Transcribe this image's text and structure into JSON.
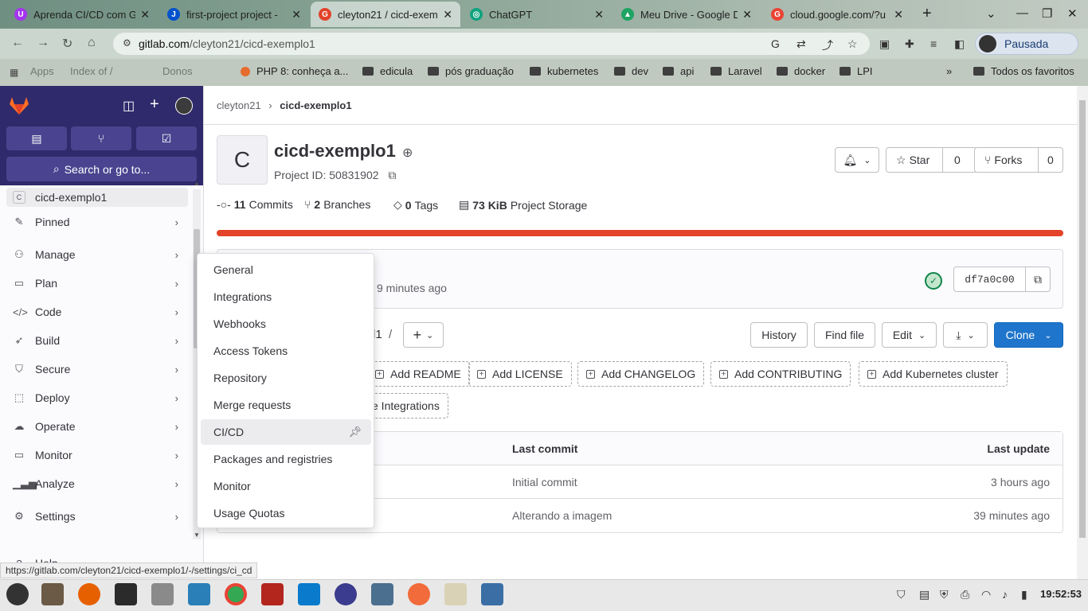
{
  "browser": {
    "tabs": [
      {
        "label": "Aprenda CI/CD com G",
        "icon": "udemy-icon",
        "color": "#a435f0"
      },
      {
        "label": "first-project project -",
        "icon": "jira-icon",
        "color": "#0052cc"
      },
      {
        "label": "cleyton21 / cicd-exem",
        "icon": "gitlab-icon",
        "color": "#e24329"
      },
      {
        "label": "ChatGPT",
        "icon": "chatgpt-icon",
        "color": "#10a37f"
      },
      {
        "label": "Meu Drive - Google D",
        "icon": "google-drive-icon",
        "color": "#1fa463"
      },
      {
        "label": "cloud.google.com/?u",
        "icon": "google-icon",
        "color": "#ea4335"
      }
    ],
    "new_tab": "+",
    "url_domain": "gitlab.com",
    "url_path": "/cleyton21/cicd-exemplo1",
    "profile_label": "Pausada",
    "bookmarks": [
      "Apps",
      "Index of /",
      "Donos",
      "PHP 8: conheça a...",
      "edicula",
      "pós graduação",
      "kubernetes",
      "dev",
      "api",
      "Laravel",
      "docker",
      "LPI"
    ],
    "bookmarks_more": "»",
    "all_bookmarks": "Todos os favoritos"
  },
  "sidebar": {
    "search_label": "Search or go to...",
    "project_badge": "C",
    "project_name": "cicd-exemplo1",
    "items": [
      {
        "label": "Pinned",
        "icon": "pin-icon"
      },
      {
        "label": "Manage",
        "icon": "users-icon"
      },
      {
        "label": "Plan",
        "icon": "plan-icon"
      },
      {
        "label": "Code",
        "icon": "code-icon"
      },
      {
        "label": "Build",
        "icon": "rocket-icon"
      },
      {
        "label": "Secure",
        "icon": "shield-icon"
      },
      {
        "label": "Deploy",
        "icon": "deploy-icon"
      },
      {
        "label": "Operate",
        "icon": "cloud-gear-icon"
      },
      {
        "label": "Monitor",
        "icon": "monitor-icon"
      },
      {
        "label": "Analyze",
        "icon": "chart-icon"
      },
      {
        "label": "Settings",
        "icon": "gear-icon"
      }
    ],
    "help_label": "Help"
  },
  "flyout": {
    "items": [
      "General",
      "Integrations",
      "Webhooks",
      "Access Tokens",
      "Repository",
      "Merge requests",
      "CI/CD",
      "Packages and registries",
      "Monitor",
      "Usage Quotas"
    ],
    "hovered_index": 6
  },
  "main": {
    "breadcrumb_owner": "cleyton21",
    "breadcrumb_sep": "›",
    "breadcrumb_project": "cicd-exemplo1",
    "project_avatar": "C",
    "project_title": "cicd-exemplo1",
    "project_id": "Project ID: 50831902",
    "star_label": "Star",
    "star_count": "0",
    "forks_label": "Forks",
    "forks_count": "0",
    "stats": {
      "commits_count": "11",
      "commits_label": "Commits",
      "branches_count": "2",
      "branches_label": "Branches",
      "tags_count": "0",
      "tags_label": "Tags",
      "storage_size": "73 KiB",
      "storage_label": "Project Storage"
    },
    "last_commit_time": "9 minutes ago",
    "commit_sha": "df7a0c00",
    "path_fragment": "l1",
    "path_sep": "/",
    "add_menu": "+",
    "history_label": "History",
    "find_file_label": "Find file",
    "edit_label": "Edit",
    "clone_label": "Clone",
    "suggestions": [
      "Add README",
      "Add LICENSE",
      "Add CHANGELOG",
      "Add CONTRIBUTING",
      "Add Kubernetes cluster"
    ],
    "integrations_fragment": "e Integrations",
    "table_headers": {
      "last_commit": "Last commit",
      "last_update": "Last update"
    },
    "rows": [
      {
        "commit": "Initial commit",
        "updated": "3 hours ago"
      },
      {
        "commit": "Alterando a imagem",
        "updated": "39 minutes ago"
      }
    ]
  },
  "status_url": "https://gitlab.com/cleyton21/cicd-exemplo1/-/settings/ci_cd",
  "clock": "19:52:53"
}
